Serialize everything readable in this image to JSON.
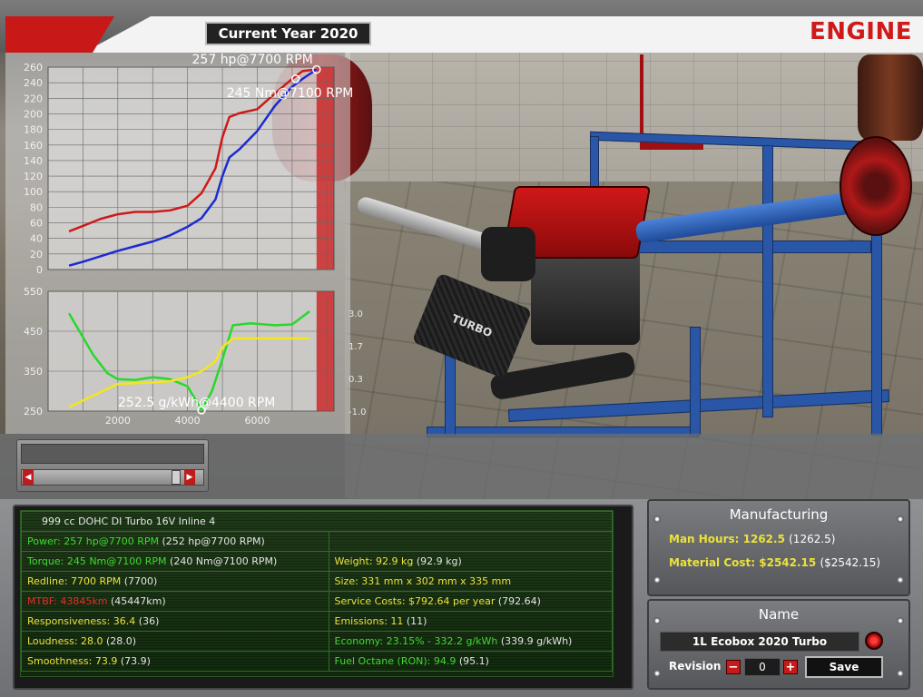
{
  "header": {
    "year_label": "Current Year 2020",
    "section_title": "ENGINE"
  },
  "chart_data": [
    {
      "type": "line",
      "title": "",
      "xlim": [
        0,
        8200
      ],
      "ylim": [
        0,
        260
      ],
      "y_ticks": [
        "260",
        "240",
        "220",
        "200",
        "180",
        "160",
        "140",
        "120",
        "100",
        "80",
        "60",
        "40",
        "20",
        "0"
      ],
      "series": [
        {
          "color": "#cc1a1a",
          "x": [
            600,
            1000,
            1500,
            2000,
            2500,
            3000,
            3500,
            4000,
            4400,
            4800,
            5000,
            5200,
            5500,
            6000,
            6500,
            7000,
            7300,
            7700
          ],
          "values": [
            49,
            56,
            65,
            71,
            74,
            74,
            76,
            82,
            98,
            130,
            170,
            196,
            201,
            206,
            226,
            245,
            255,
            257
          ]
        },
        {
          "color": "#1c2ad0",
          "x": [
            600,
            1000,
            1500,
            2000,
            2500,
            3000,
            3500,
            4000,
            4400,
            4800,
            5000,
            5200,
            5500,
            6000,
            6500,
            7000,
            7300,
            7700
          ],
          "values": [
            5,
            10,
            17,
            24,
            30,
            36,
            44,
            55,
            66,
            90,
            120,
            144,
            155,
            178,
            210,
            235,
            245,
            257
          ]
        }
      ],
      "annotations": [
        {
          "text": "257 hp@7700 RPM",
          "x": 7700,
          "y": 257
        },
        {
          "text": "245 Nm@7100 RPM",
          "x": 7100,
          "y": 245
        }
      ],
      "redline_x": 7700
    },
    {
      "type": "line",
      "title": "",
      "xlim": [
        0,
        8200
      ],
      "ylim": [
        250,
        550
      ],
      "x_ticks": [
        "2000",
        "4000",
        "6000"
      ],
      "y_ticks": [
        "550",
        "450",
        "350",
        "250"
      ],
      "right_ticks": [
        "3.0",
        "1.7",
        "0.3",
        "-1.0"
      ],
      "series": [
        {
          "color": "#28d82a",
          "x": [
            600,
            900,
            1300,
            1700,
            2000,
            2500,
            3000,
            3500,
            4000,
            4400,
            4700,
            5000,
            5300,
            5800,
            6500,
            7000,
            7500
          ],
          "values": [
            495,
            450,
            390,
            345,
            330,
            328,
            335,
            330,
            312,
            253,
            300,
            380,
            465,
            470,
            465,
            467,
            500
          ]
        },
        {
          "color": "#f2e61e",
          "x": [
            600,
            1200,
            2000,
            2500,
            3000,
            3500,
            4000,
            4400,
            4800,
            5000,
            5300,
            6000,
            7000,
            7500
          ],
          "values": [
            260,
            285,
            318,
            320,
            322,
            325,
            335,
            350,
            375,
            410,
            432,
            432,
            432,
            432
          ]
        }
      ],
      "annotations": [
        {
          "text": "252.5 g/kWh@4400 RPM",
          "x": 4400,
          "y": 252.5
        }
      ],
      "redline_x": 7700
    }
  ],
  "stats": {
    "engine_name": "999 cc DOHC DI Turbo 16V Inline 4",
    "rows": [
      {
        "left": "Power: 257 hp@7700 RPM",
        "left_ref": "(252 hp@7700 RPM)",
        "left_color": "green",
        "right": "",
        "right_ref": "",
        "right_color": "white"
      },
      {
        "left": "Torque: 245 Nm@7100 RPM",
        "left_ref": "(240 Nm@7100 RPM)",
        "left_color": "green",
        "right": "Weight: 92.9 kg",
        "right_ref": "(92.9 kg)",
        "right_color": "yellow"
      },
      {
        "left": "Redline: 7700 RPM",
        "left_ref": "(7700)",
        "left_color": "yellow",
        "right": "Size: 331 mm x 302 mm x 335 mm",
        "right_ref": "",
        "right_color": "yellow"
      },
      {
        "left": "MTBF: 43845km",
        "left_ref": "(45447km)",
        "left_color": "red",
        "right": "Service Costs: $792.64 per year",
        "right_ref": "(792.64)",
        "right_color": "yellow"
      },
      {
        "left": "Responsiveness: 36.4",
        "left_ref": "(36)",
        "left_color": "yellow",
        "right": "Emissions: 11",
        "right_ref": "(11)",
        "right_color": "yellow"
      },
      {
        "left": "Loudness: 28.0",
        "left_ref": "(28.0)",
        "left_color": "yellow",
        "right": "Economy: 23.15% - 332.2 g/kWh",
        "right_ref": "(339.9 g/kWh)",
        "right_color": "green"
      },
      {
        "left": "Smoothness: 73.9",
        "left_ref": "(73.9)",
        "left_color": "yellow",
        "right": "Fuel Octane (RON): 94.9",
        "right_ref": "(95.1)",
        "right_color": "green"
      }
    ]
  },
  "manufacturing": {
    "title": "Manufacturing",
    "man_hours_label": "Man Hours: 1262.5",
    "man_hours_ref": "(1262.5)",
    "material_cost_label": "Material Cost: $2542.15",
    "material_cost_ref": "($2542.15)"
  },
  "name_panel": {
    "title": "Name",
    "engine_name": "1L Ecobox 2020 Turbo",
    "revision_label": "Revision",
    "revision_value": "0",
    "minus": "−",
    "plus": "+",
    "save_label": "Save"
  },
  "scene": {
    "turbo_label": "TURBO"
  },
  "colors": {
    "accent_red": "#c81818",
    "panel_green": "#1f3a18",
    "label_yellow": "#ece23a",
    "label_green": "#3cdc2c"
  }
}
